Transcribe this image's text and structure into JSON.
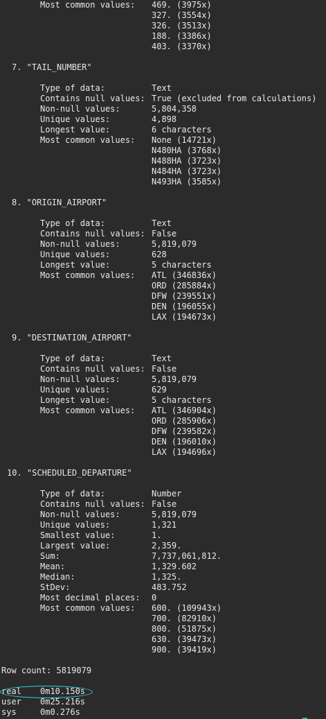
{
  "header_values": [
    "469. (3975x)",
    "327. (3554x)",
    "326. (3513x)",
    "188. (3386x)",
    "403. (3370x)"
  ],
  "header_label": "Most common values:",
  "sections": {
    "tail_number": {
      "heading": "7. \"TAIL_NUMBER\"",
      "rows": [
        {
          "label": "Type of data:",
          "value": "Text"
        },
        {
          "label": "Contains null values:",
          "value": "True (excluded from calculations)"
        },
        {
          "label": "Non-null values:",
          "value": "5,804,358"
        },
        {
          "label": "Unique values:",
          "value": "4,898"
        },
        {
          "label": "Longest value:",
          "value": "6 characters"
        },
        {
          "label": "Most common values:",
          "value": "None (14721x)"
        }
      ],
      "extra_values": [
        "N480HA (3768x)",
        "N488HA (3723x)",
        "N484HA (3723x)",
        "N493HA (3585x)"
      ]
    },
    "origin_airport": {
      "heading": "8. \"ORIGIN_AIRPORT\"",
      "rows": [
        {
          "label": "Type of data:",
          "value": "Text"
        },
        {
          "label": "Contains null values:",
          "value": "False"
        },
        {
          "label": "Non-null values:",
          "value": "5,819,079"
        },
        {
          "label": "Unique values:",
          "value": "628"
        },
        {
          "label": "Longest value:",
          "value": "5 characters"
        },
        {
          "label": "Most common values:",
          "value": "ATL (346836x)"
        }
      ],
      "extra_values": [
        "ORD (285884x)",
        "DFW (239551x)",
        "DEN (196055x)",
        "LAX (194673x)"
      ]
    },
    "destination_airport": {
      "heading": "9. \"DESTINATION_AIRPORT\"",
      "rows": [
        {
          "label": "Type of data:",
          "value": "Text"
        },
        {
          "label": "Contains null values:",
          "value": "False"
        },
        {
          "label": "Non-null values:",
          "value": "5,819,079"
        },
        {
          "label": "Unique values:",
          "value": "629"
        },
        {
          "label": "Longest value:",
          "value": "5 characters"
        },
        {
          "label": "Most common values:",
          "value": "ATL (346904x)"
        }
      ],
      "extra_values": [
        "ORD (285906x)",
        "DFW (239582x)",
        "DEN (196010x)",
        "LAX (194696x)"
      ]
    },
    "scheduled_departure": {
      "heading": "10. \"SCHEDULED_DEPARTURE\"",
      "rows": [
        {
          "label": "Type of data:",
          "value": "Number"
        },
        {
          "label": "Contains null values:",
          "value": "False"
        },
        {
          "label": "Non-null values:",
          "value": "5,819,079"
        },
        {
          "label": "Unique values:",
          "value": "1,321"
        },
        {
          "label": "Smallest value:",
          "value": "1."
        },
        {
          "label": "Largest value:",
          "value": "2,359."
        },
        {
          "label": "Sum:",
          "value": "7,737,061,812."
        },
        {
          "label": "Mean:",
          "value": "1,329.602"
        },
        {
          "label": "Median:",
          "value": "1,325."
        },
        {
          "label": "StDev:",
          "value": "483.752"
        },
        {
          "label": "Most decimal places:",
          "value": "0"
        },
        {
          "label": "Most common values:",
          "value": "600. (109943x)"
        }
      ],
      "extra_values": [
        "700. (82910x)",
        "800. (51875x)",
        "630. (39473x)",
        "900. (39419x)"
      ]
    }
  },
  "row_count": "Row count: 5819079",
  "timing": [
    {
      "label": "real",
      "value": "0m10.150s"
    },
    {
      "label": "user",
      "value": "0m25.216s"
    },
    {
      "label": "sys",
      "value": "0m0.276s"
    }
  ],
  "colors": {
    "background": "#2b2b2b",
    "text": "#e8e8e8",
    "annotation": "#2fd0e6",
    "cursor": "#22c55e"
  }
}
